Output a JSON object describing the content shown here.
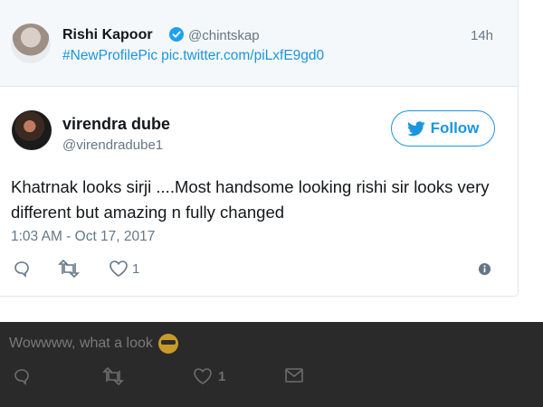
{
  "parent_tweet": {
    "name": "Rishi Kapoor",
    "handle": "@chintskap",
    "time": "14h",
    "hashtag": "#NewProfilePic",
    "link": "pic.twitter.com/piLxfE9gd0"
  },
  "tweet": {
    "name": "virendra dube",
    "handle": "@virendradube1",
    "follow_label": "Follow",
    "text": "Khatrnak looks sirji ....Most handsome looking rishi sir looks very different but amazing n fully changed",
    "timestamp": "1:03 AM - Oct 17, 2017",
    "like_count": "1"
  },
  "background_reply": {
    "text": "Wowwww, what a look",
    "like_count": "1"
  },
  "colors": {
    "link": "#1b95e0",
    "muted": "#657786",
    "overlay": "#2a2a2a"
  }
}
